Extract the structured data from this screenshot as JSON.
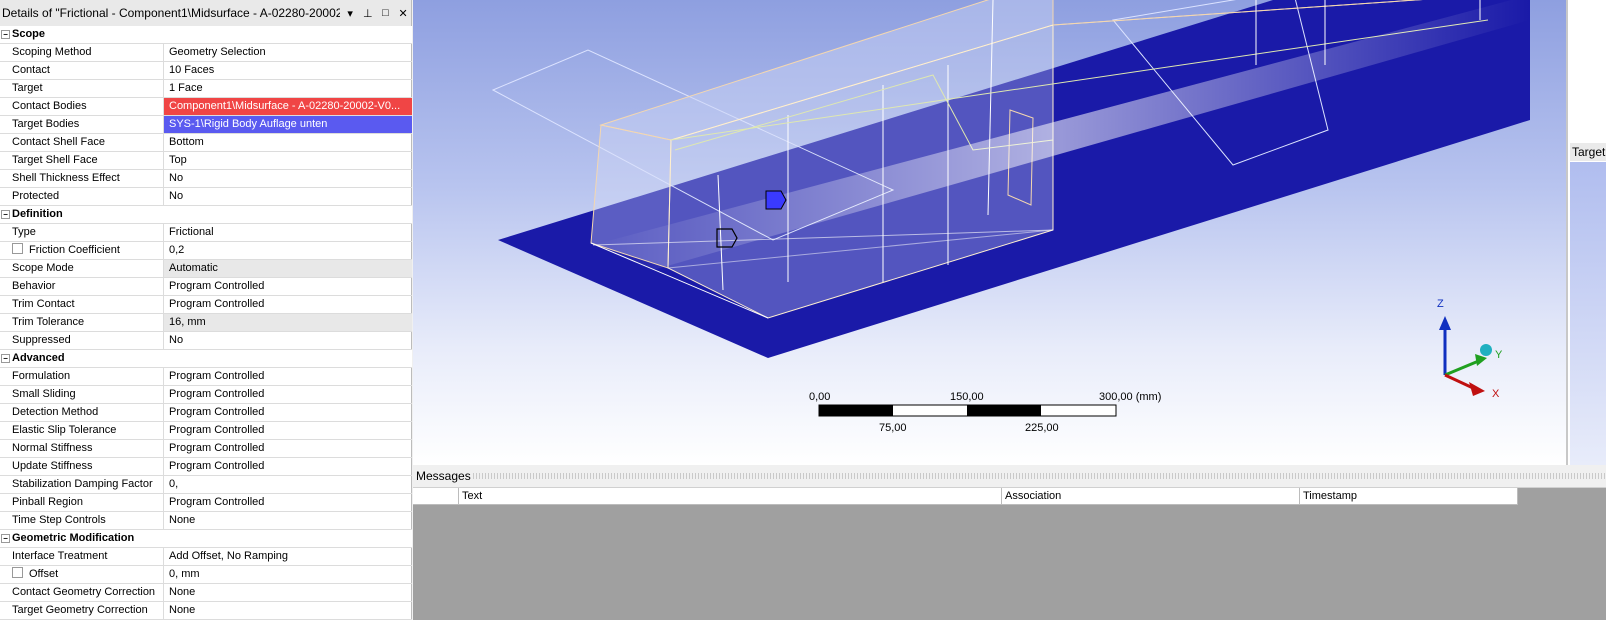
{
  "details": {
    "title": "Details of \"Frictional - Component1\\Midsurface - A-02280-20002-",
    "buttons": {
      "dropdown": "▾",
      "pin": "⊥",
      "maximize": "□",
      "close": "✕"
    },
    "sections": [
      {
        "name": "Scope",
        "rows": [
          {
            "key": "Scoping Method",
            "value": "Geometry Selection"
          },
          {
            "key": "Contact",
            "value": "10 Faces"
          },
          {
            "key": "Target",
            "value": "1 Face"
          },
          {
            "key": "Contact Bodies",
            "value": "Component1\\Midsurface - A-02280-20002-V0...",
            "style": "red"
          },
          {
            "key": "Target Bodies",
            "value": "SYS-1\\Rigid Body Auflage unten",
            "style": "blue"
          },
          {
            "key": "Contact Shell Face",
            "value": "Bottom"
          },
          {
            "key": "Target Shell Face",
            "value": "Top"
          },
          {
            "key": "Shell Thickness Effect",
            "value": "No"
          },
          {
            "key": "Protected",
            "value": "No"
          }
        ]
      },
      {
        "name": "Definition",
        "rows": [
          {
            "key": "Type",
            "value": "Frictional"
          },
          {
            "key": "Friction Coefficient",
            "value": "0,2",
            "checkbox": true
          },
          {
            "key": "Scope Mode",
            "value": "Automatic",
            "style": "gray"
          },
          {
            "key": "Behavior",
            "value": "Program Controlled"
          },
          {
            "key": "Trim Contact",
            "value": "Program Controlled"
          },
          {
            "key": "Trim Tolerance",
            "value": "16, mm",
            "style": "gray"
          },
          {
            "key": "Suppressed",
            "value": "No"
          }
        ]
      },
      {
        "name": "Advanced",
        "rows": [
          {
            "key": "Formulation",
            "value": "Program Controlled"
          },
          {
            "key": "Small Sliding",
            "value": "Program Controlled"
          },
          {
            "key": "Detection Method",
            "value": "Program Controlled"
          },
          {
            "key": "Elastic Slip Tolerance",
            "value": "Program Controlled"
          },
          {
            "key": "Normal Stiffness",
            "value": "Program Controlled"
          },
          {
            "key": "Update Stiffness",
            "value": "Program Controlled"
          },
          {
            "key": "Stabilization Damping Factor",
            "value": "0,"
          },
          {
            "key": "Pinball Region",
            "value": "Program Controlled"
          },
          {
            "key": "Time Step Controls",
            "value": "None"
          }
        ]
      },
      {
        "name": "Geometric Modification",
        "rows": [
          {
            "key": "Interface Treatment",
            "value": "Add Offset, No Ramping"
          },
          {
            "key": "Offset",
            "value": "0, mm",
            "checkbox": true
          },
          {
            "key": "Contact Geometry Correction",
            "value": "None"
          },
          {
            "key": "Target Geometry Correction",
            "value": "None"
          }
        ]
      }
    ]
  },
  "viewport": {
    "scale": {
      "top_labels": [
        "0,00",
        "150,00",
        "300,00 (mm)"
      ],
      "bottom_labels": [
        "75,00",
        "225,00"
      ]
    },
    "triad": {
      "z": "Z",
      "y": "Y",
      "x": "X"
    },
    "colors": {
      "target_face": "#1a1aa8",
      "contact_marker": "#3a3aff"
    }
  },
  "right_panel": {
    "tab": "Target"
  },
  "messages": {
    "title": "Messages",
    "columns": [
      "Text",
      "Association",
      "Timestamp"
    ]
  }
}
